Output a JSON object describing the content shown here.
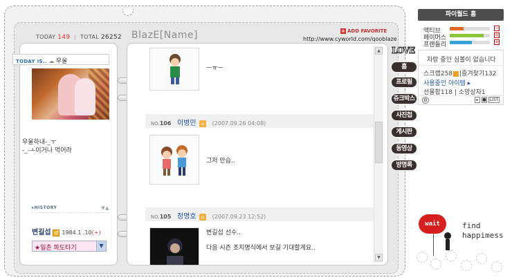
{
  "visitors": {
    "today_label": "TODAY",
    "today_count": "149",
    "total_label": "TOTAL",
    "total_count": "26252"
  },
  "home_title": "BlazE[Name]",
  "add_favorite": "ADD FAVORITE",
  "home_url": "http://www.cyworld.com/qooblaze",
  "profile": {
    "today_is_label": "TODAY IS..",
    "mood": "우울",
    "message": "우울하내-_ㅜ\n-_-ㅗ이거나 먹어라",
    "history_label": "HISTORY",
    "owner_name": "변길섭",
    "birth": "1984.1 .10",
    "birth_plus": "(+)",
    "ilchon_select": "★일촌 파도타기"
  },
  "entries": [
    {
      "text": "ㅡㅠㅡ"
    },
    {
      "no_label": "NO.",
      "no": "106",
      "writer": "이병민",
      "date": "(2007.09.26 04:08)",
      "text": "그저 안습.."
    },
    {
      "no_label": "NO.",
      "no": "105",
      "writer": "정명호",
      "date": "(2007.09.23 12:52)",
      "text_line1": "변길섭 선수..",
      "text_line2": "다음 시즌 조지명식에서 보길 기대할게요.."
    }
  ],
  "menu": {
    "love": "LOVE",
    "items": [
      "홈",
      "프로필",
      "쥬크박스",
      "사진첩",
      "게시판",
      "동영상",
      "방명록"
    ]
  },
  "widget": {
    "title": "파이월드 홈",
    "stats": [
      {
        "label": "액티브",
        "level": 0.35,
        "color": "#e06a2a",
        "ctl": "−"
      },
      {
        "label": "페이머스",
        "level": 0.85,
        "color": "#8ac43a",
        "ctl": "+"
      },
      {
        "label": "프랜들리",
        "level": 0.55,
        "color": "#3aa0d8",
        "ctl": "+"
      }
    ],
    "no_song": "자랑 중인 심볼이 없습니다",
    "scrap_label": "스크랩",
    "scrap_count": "258",
    "fav_label": "즐겨찾기",
    "fav_count": "132",
    "items_in_use": "사용중인 아이템 ▸",
    "gift_label": "선물함",
    "gift_count": "118",
    "wish_label": "소망상자",
    "wish_count": "1",
    "list_btn": "LIST"
  },
  "deco": {
    "wait": "wait",
    "find": "find\nhappimess"
  }
}
